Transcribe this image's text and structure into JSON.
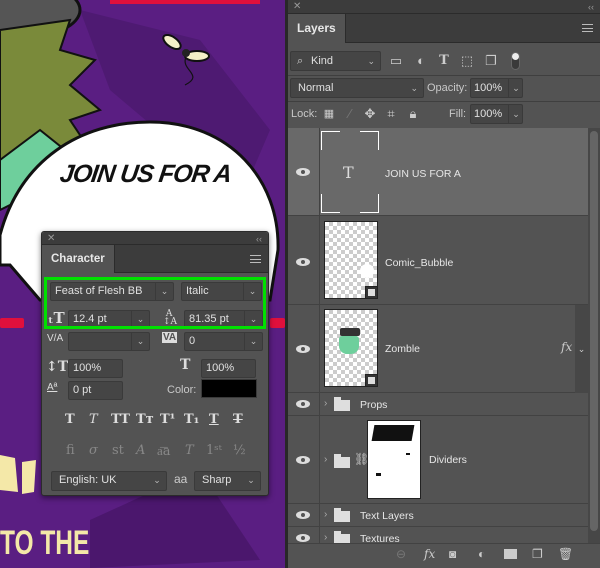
{
  "canvas": {
    "speech_text": "JOIN US FOR A",
    "bottom_text": "TO THE",
    "colors": {
      "background": "#5a1e82",
      "bubble": "#ffffff",
      "accent_red": "#e0103c",
      "cream_text": "#f4e8a8",
      "zombie_green": "#6ecf9c",
      "hair_olive": "#7a8a3a"
    }
  },
  "layers_panel": {
    "tab_label": "Layers",
    "filter_kind": "Kind",
    "blend_mode": "Normal",
    "opacity_label": "Opacity:",
    "opacity_value": "100%",
    "lock_label": "Lock:",
    "fill_label": "Fill:",
    "fill_value": "100%",
    "layers": [
      {
        "name": "JOIN US FOR A",
        "type": "text",
        "visible": true,
        "selected": true
      },
      {
        "name": "Comic_Bubble",
        "type": "smart-object",
        "visible": true
      },
      {
        "name": "Zomble",
        "type": "smart-object",
        "visible": true,
        "effects": "fx"
      },
      {
        "name": "Props",
        "type": "group",
        "visible": true
      },
      {
        "name": "Dividers",
        "type": "group-with-mask",
        "visible": true
      },
      {
        "name": "Text Layers",
        "type": "group",
        "visible": true
      },
      {
        "name": "Textures",
        "type": "group",
        "visible": true
      }
    ]
  },
  "character_panel": {
    "tab_label": "Character",
    "font_family": "Feast of Flesh BB",
    "font_style": "Italic",
    "font_size": "12.4 pt",
    "leading": "81.35 pt",
    "kerning": "",
    "tracking": "0",
    "vertical_scale": "100%",
    "horizontal_scale": "100%",
    "baseline_shift": "0 pt",
    "color_label": "Color:",
    "color_value": "#000000",
    "language": "English: UK",
    "antialias_icon": "aa",
    "antialias": "Sharp",
    "highlight_color": "#00e000"
  }
}
